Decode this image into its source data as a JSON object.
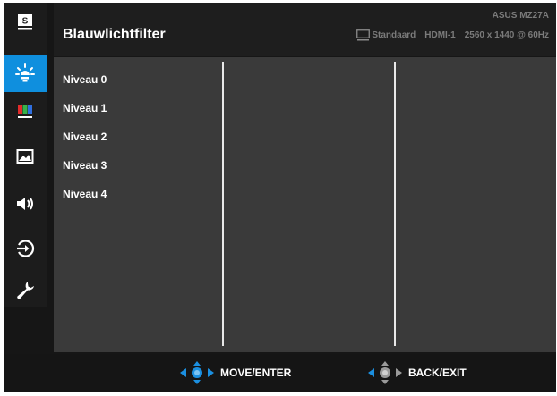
{
  "header": {
    "title": "Blauwlichtfilter",
    "model": "ASUS MZ27A",
    "mode": "Standaard",
    "input": "HDMI-1",
    "resolution": "2560 x 1440 @ 60Hz"
  },
  "sidebar": {
    "items": [
      {
        "icon": "splendid-icon",
        "label": "S",
        "active": false
      },
      {
        "icon": "blue-light-icon",
        "active": true
      },
      {
        "icon": "color-icon",
        "active": false
      },
      {
        "icon": "image-icon",
        "active": false
      },
      {
        "icon": "sound-icon",
        "active": false
      },
      {
        "icon": "input-select-icon",
        "active": false
      },
      {
        "icon": "system-setup-icon",
        "active": false
      }
    ]
  },
  "options": [
    {
      "label": "Niveau 0"
    },
    {
      "label": "Niveau 1"
    },
    {
      "label": "Niveau 2"
    },
    {
      "label": "Niveau 3"
    },
    {
      "label": "Niveau 4"
    }
  ],
  "footer": {
    "move_label": "MOVE/ENTER",
    "back_label": "BACK/EXIT"
  },
  "colors": {
    "accent": "#0f8fde",
    "background": "#161616",
    "panel": "#3a3a3a"
  }
}
